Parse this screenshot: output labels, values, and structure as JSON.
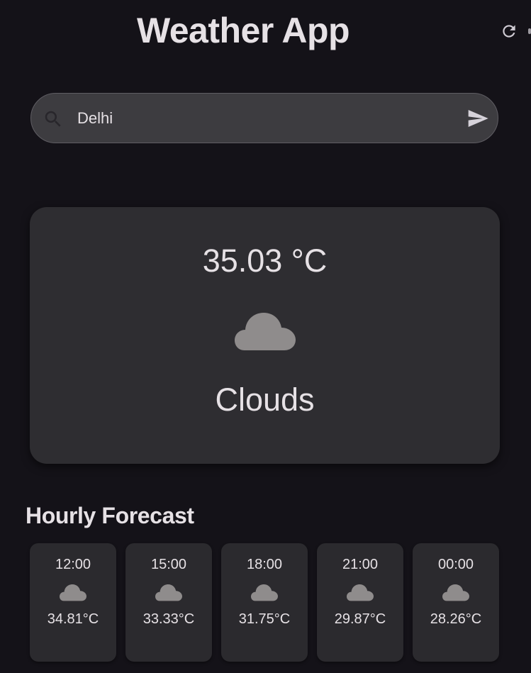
{
  "app": {
    "title": "Weather App",
    "refresh_icon": "refresh-icon"
  },
  "search": {
    "value": "Delhi",
    "placeholder": "",
    "search_icon": "search-icon",
    "send_icon": "send-icon"
  },
  "current": {
    "temperature": "35.03 °C",
    "icon": "cloud-icon",
    "condition": "Clouds"
  },
  "forecast": {
    "title": "Hourly Forecast",
    "items": [
      {
        "time": "12:00",
        "icon": "cloud-icon",
        "temp": "34.81°C"
      },
      {
        "time": "15:00",
        "icon": "cloud-icon",
        "temp": "33.33°C"
      },
      {
        "time": "18:00",
        "icon": "cloud-icon",
        "temp": "31.75°C"
      },
      {
        "time": "21:00",
        "icon": "cloud-icon",
        "temp": "29.87°C"
      },
      {
        "time": "00:00",
        "icon": "cloud-icon",
        "temp": "28.26°C"
      }
    ]
  },
  "colors": {
    "background": "#141218",
    "card": "#2e2d31",
    "text": "#e6e1e5",
    "icon": "#8f8c8c"
  }
}
